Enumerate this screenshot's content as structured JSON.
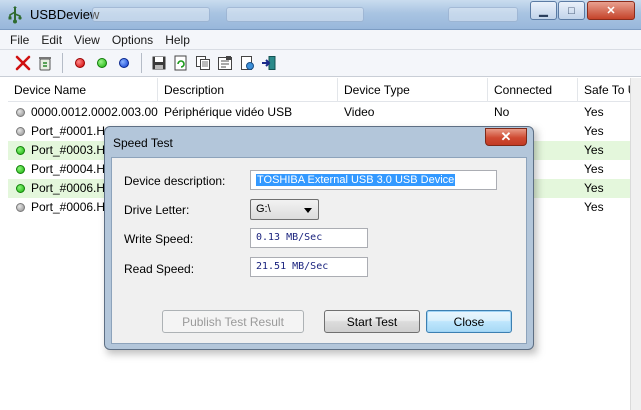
{
  "window": {
    "title": "USBDeview",
    "caption_buttons": [
      "minimize",
      "maximize",
      "close"
    ]
  },
  "menu": [
    "File",
    "Edit",
    "View",
    "Options",
    "Help"
  ],
  "toolbar": {
    "icons": [
      "uninstall-icon",
      "recycle-icon",
      "red-dot-icon",
      "green-dot-icon",
      "blue-dot-icon",
      "save-icon",
      "refresh-icon",
      "copy-icon",
      "properties-icon",
      "html-report-icon",
      "exit-icon"
    ]
  },
  "list": {
    "columns": [
      "Device Name",
      "Description",
      "Device Type",
      "Connected",
      "Safe To U"
    ],
    "rows": [
      {
        "name": "0000.0012.0002.003.00...",
        "description": "Périphérique vidéo USB",
        "type": "Video",
        "connected": "No",
        "safe": "Yes",
        "status": "grey"
      },
      {
        "name": "Port_#0001.Hu",
        "description": "",
        "type": "",
        "connected": "",
        "safe": "Yes",
        "status": "grey"
      },
      {
        "name": "Port_#0003.Hu",
        "description": "",
        "type": "",
        "connected": "",
        "safe": "Yes",
        "status": "green"
      },
      {
        "name": "Port_#0004.Hu",
        "description": "",
        "type": "",
        "connected": "",
        "safe": "Yes",
        "status": "green"
      },
      {
        "name": "Port_#0006.Hu",
        "description": "",
        "type": "",
        "connected": "",
        "safe": "Yes",
        "status": "green"
      },
      {
        "name": "Port_#0006.Hu",
        "description": "",
        "type": "",
        "connected": "",
        "safe": "Yes",
        "status": "grey"
      }
    ]
  },
  "dialog": {
    "title": "Speed Test",
    "close_glyph": "✕",
    "fields": {
      "device_description_label": "Device description:",
      "device_description_value": "TOSHIBA External USB 3.0 USB Device",
      "drive_letter_label": "Drive Letter:",
      "drive_letter_value": "G:\\",
      "write_speed_label": "Write Speed:",
      "write_speed_value": "0.13  MB/Sec",
      "read_speed_label": "Read Speed:",
      "read_speed_value": "21.51  MB/Sec"
    },
    "buttons": {
      "publish": "Publish Test Result",
      "start": "Start Test",
      "close": "Close"
    }
  },
  "colors": {
    "connected_row": "#e4f7dc",
    "selection": "#3399ff",
    "dialog_frame": "#b3c6da"
  }
}
